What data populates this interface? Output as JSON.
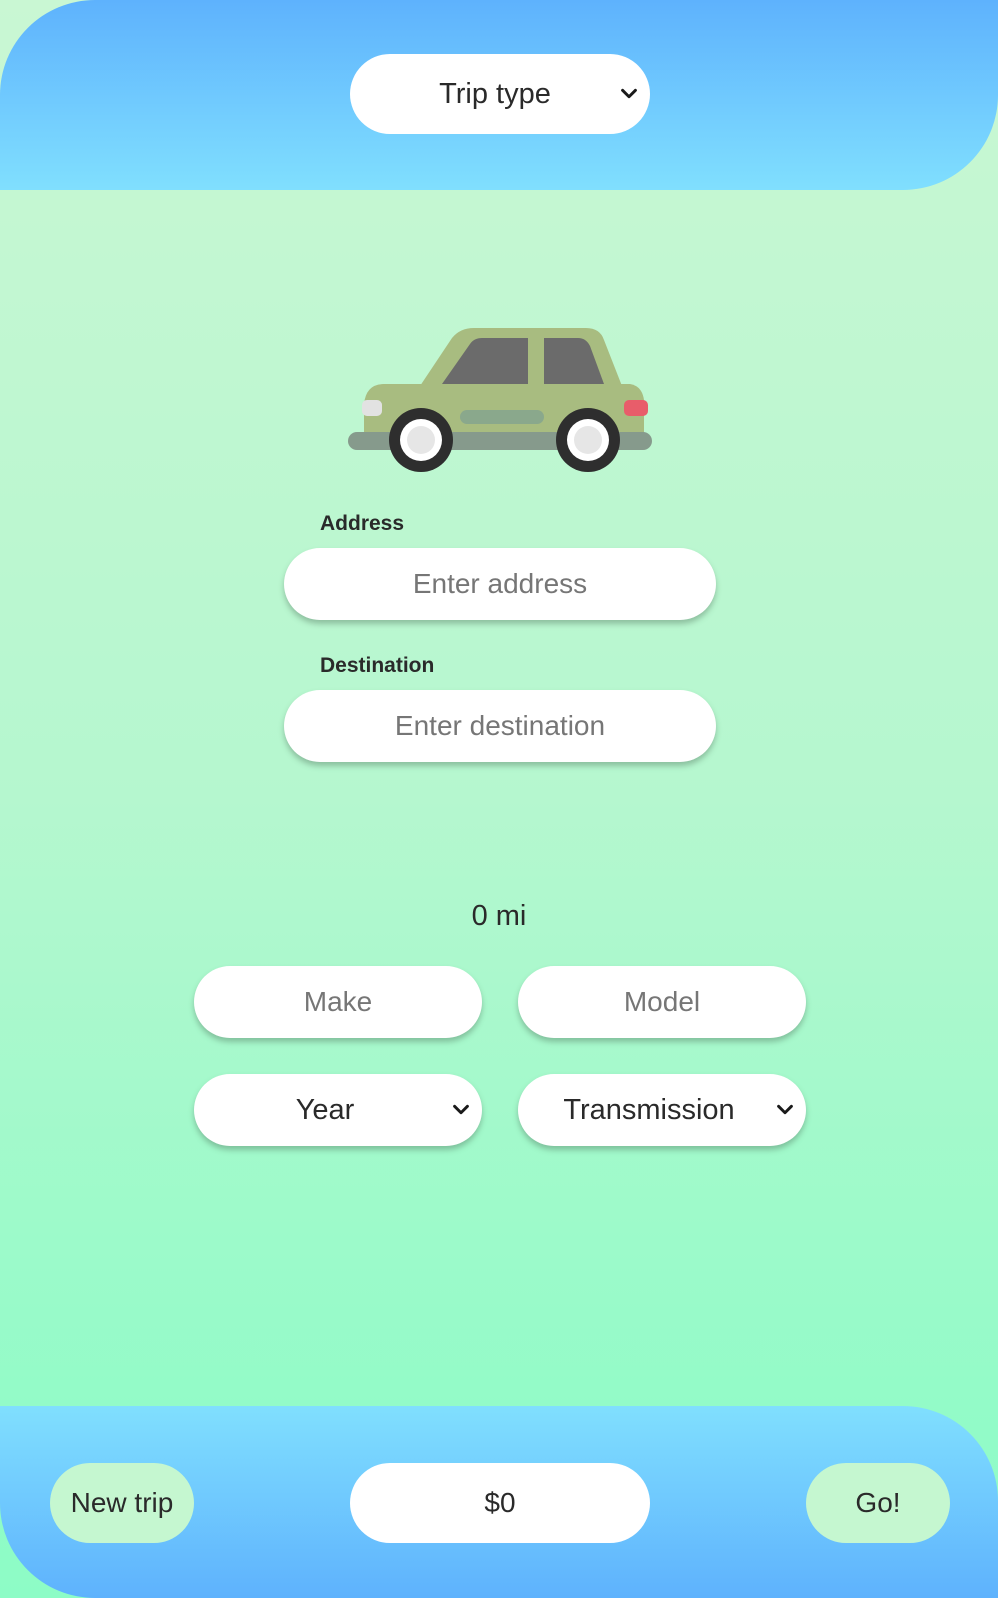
{
  "header": {
    "trip_type": "Trip type"
  },
  "form": {
    "address_label": "Address",
    "address_placeholder": "Enter address",
    "destination_label": "Destination",
    "destination_placeholder": "Enter destination",
    "distance": "0 mi",
    "make_placeholder": "Make",
    "model_placeholder": "Model",
    "year": "Year",
    "transmission": "Transmission"
  },
  "footer": {
    "new_trip_label": "New trip",
    "price": "$0",
    "go_label": "Go!"
  },
  "icons": {
    "car": "car-icon",
    "dropdown": "chevron-down-icon"
  },
  "colors": {
    "header_top": "#5eb2fd",
    "header_bottom": "#80dffe",
    "background_top": "#c9f7d3",
    "background_bottom": "#8dfcc6",
    "button_green": "#c5f7d0",
    "car_body": "#a8bc80",
    "car_taillight": "#e85d6a"
  }
}
